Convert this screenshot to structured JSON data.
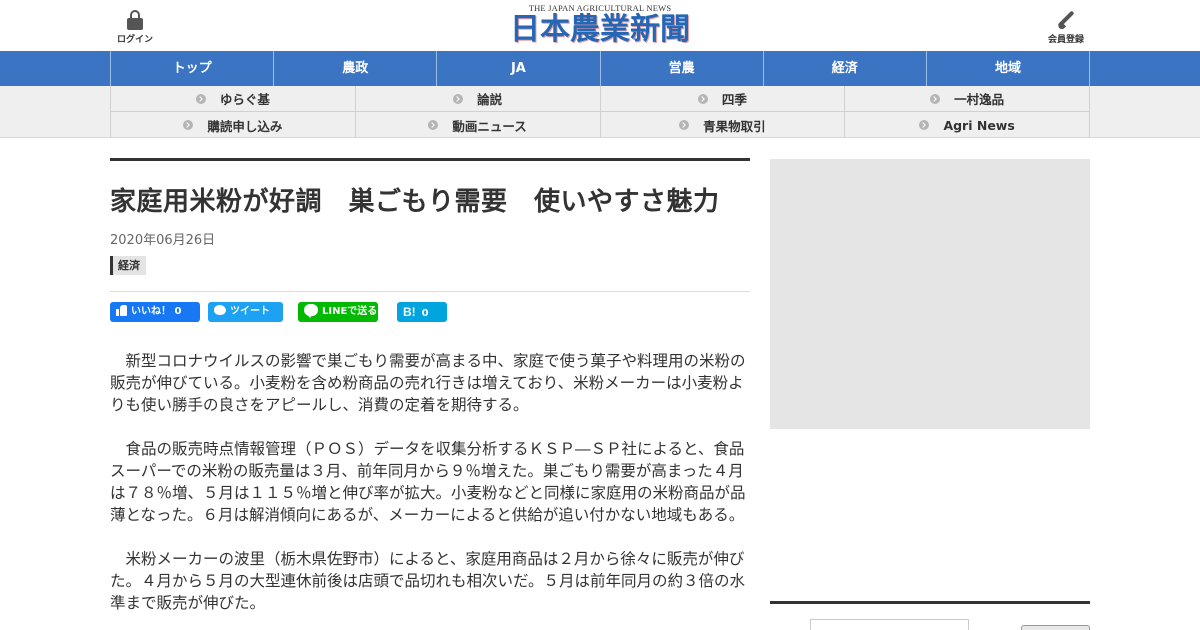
{
  "header": {
    "login_label": "ログイン",
    "register_label": "会員登録",
    "logo_en": "THE JAPAN AGRICULTURAL NEWS",
    "logo_ja": "日本農業新聞"
  },
  "main_nav": {
    "items": [
      "トップ",
      "農政",
      "JA",
      "営農",
      "経済",
      "地域"
    ]
  },
  "sub_nav": {
    "items": [
      "ゆらぐ基",
      "論説",
      "四季",
      "一村逸品",
      "購読申し込み",
      "動画ニュース",
      "青果物取引",
      "Agri News"
    ]
  },
  "article": {
    "title": "家庭用米粉が好調　巣ごもり需要　使いやすさ魅力",
    "date": "2020年06月26日",
    "category": "経済",
    "share": {
      "like_label": "いいね！",
      "like_count": "0",
      "tweet_label": "ツイート",
      "line_label": "LINEで送る",
      "hatena_mark": "B!",
      "hatena_count": "0"
    },
    "paragraphs": [
      "新型コロナウイルスの影響で巣ごもり需要が高まる中、家庭で使う菓子や料理用の米粉の販売が伸びている。小麦粉を含め粉商品の売れ行きは増えており、米粉メーカーは小麦粉よりも使い勝手の良さをアピールし、消費の定着を期待する。",
      "食品の販売時点情報管理（ＰＯＳ）データを収集分析するＫＳＰ―ＳＰ社によると、食品スーパーでの米粉の販売量は３月、前年同月から９％増えた。巣ごもり需要が高まった４月は７８％増、５月は１１５％増と伸び率が拡大。小麦粉などと同様に家庭用の米粉商品が品薄となった。６月は解消傾向にあるが、メーカーによると供給が追い付かない地域もある。",
      "米粉メーカーの波里（栃木県佐野市）によると、家庭用商品は２月から徐々に販売が伸びた。４月から５月の大型連休前後は店頭で品切れも相次いだ。５月は前年同月の約３倍の水準まで販売が伸びた。"
    ]
  },
  "colors": {
    "nav_blue": "#3a74c2",
    "logo_blue": "#2566b5",
    "facebook": "#1877f2",
    "twitter": "#1da1f2",
    "line": "#00b900",
    "hatena": "#00a4de"
  }
}
